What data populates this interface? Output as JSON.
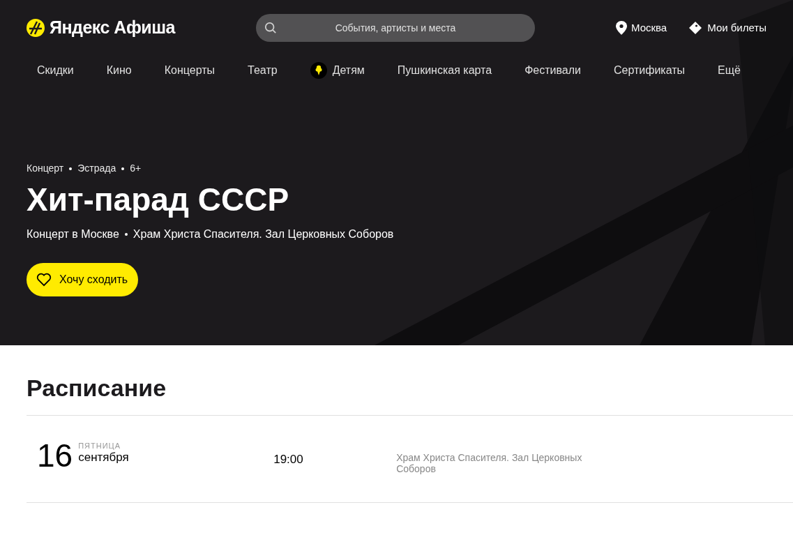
{
  "header": {
    "logo": "Яндекс Афиша",
    "search": {
      "placeholder": "События, артисты и места"
    },
    "city": "Москва",
    "tickets": "Мои билеты"
  },
  "nav": [
    {
      "label": "Скидки",
      "kind": "text"
    },
    {
      "label": "Кино",
      "kind": "text"
    },
    {
      "label": "Концерты",
      "kind": "text"
    },
    {
      "label": "Театр",
      "kind": "text"
    },
    {
      "label": "Детям",
      "kind": "icon"
    },
    {
      "label": "Пушкинская карта",
      "kind": "text"
    },
    {
      "label": "Фестивали",
      "kind": "text"
    },
    {
      "label": "Сертификаты",
      "kind": "text"
    },
    {
      "label": "Ещё",
      "kind": "text"
    }
  ],
  "event": {
    "tags": [
      "Концерт",
      "Эстрада",
      "6+"
    ],
    "title": "Хит-парад СССР",
    "info": [
      "Концерт в Москве",
      "Храм Христа Спасителя. Зал Церковных Соборов"
    ],
    "want_button": "Хочу сходить"
  },
  "schedule": {
    "title": "Расписание",
    "rows": [
      {
        "day": "16",
        "weekday": "ПЯТНИЦА",
        "month": "сентября",
        "time": "19:00",
        "venue": "Храм Христа Спасителя. Зал Церковных Соборов"
      }
    ]
  }
}
